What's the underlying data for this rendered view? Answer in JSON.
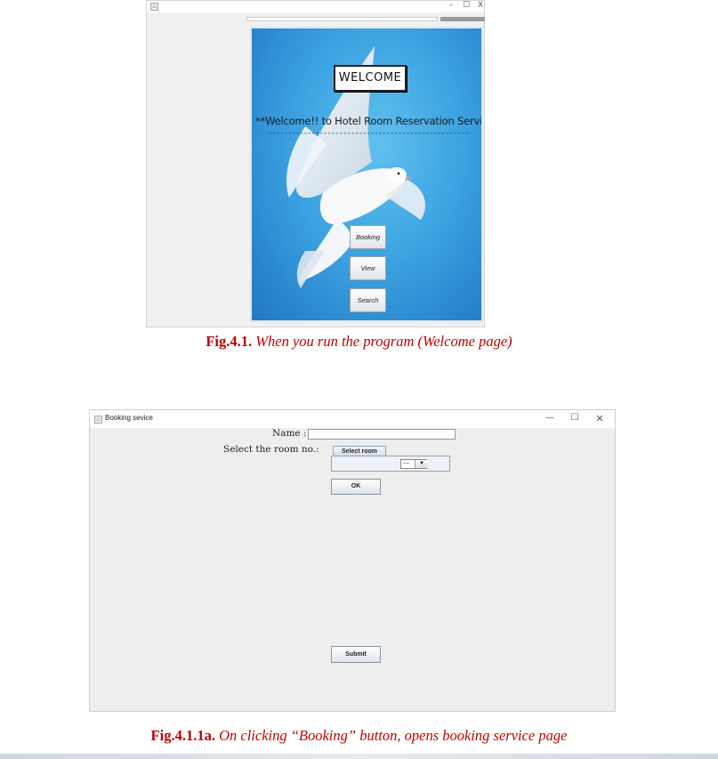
{
  "welcome_window": {
    "controls": {
      "minimize": "–",
      "maximize": "☐",
      "close": "X"
    },
    "welcome_label": "WELCOME",
    "welcome_message": "**Welcome!! to Hotel Room Reservation Service**",
    "dashes": "--------------------------------------------------------",
    "buttons": {
      "booking": "Booking",
      "view": "View",
      "search": "Search"
    }
  },
  "caption1": {
    "fig": "Fig.4.1.",
    "text": " When you run the program (Welcome page)"
  },
  "booking_window": {
    "title": "Booking sevice",
    "controls": {
      "minimize": "—",
      "maximize": "☐",
      "close": "✕"
    },
    "name_label": "Name :",
    "name_value": "",
    "room_label": "Select the room no.:",
    "room_tab": "Select room",
    "room_selected": "---",
    "ok_label": "OK",
    "submit_label": "Submit"
  },
  "caption2": {
    "fig": "Fig.4.1.1a.",
    "text": " On clicking “Booking” button, opens booking service page"
  },
  "icons": [
    "java-icon",
    "dove-image",
    "dropdown-arrow-icon"
  ]
}
